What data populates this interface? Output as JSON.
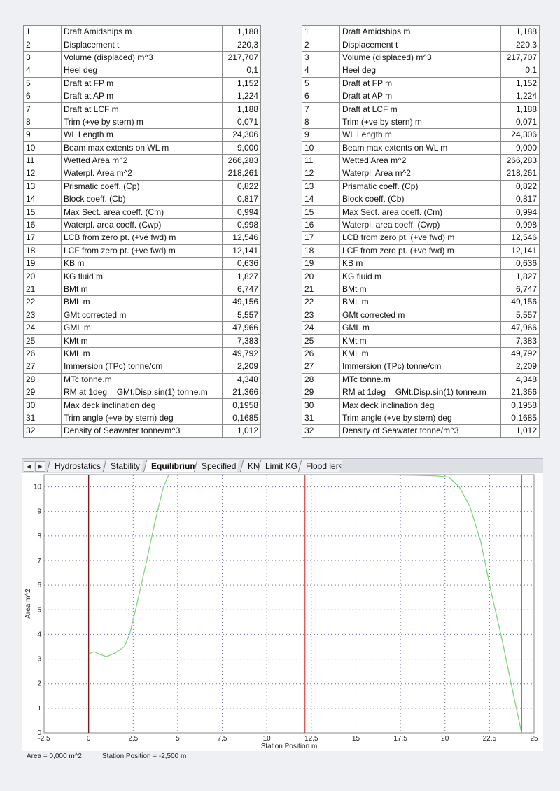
{
  "table_left": {
    "rows": [
      {
        "num": "1",
        "label": "Draft Amidships m",
        "value": "1,188"
      },
      {
        "num": "2",
        "label": "Displacement t",
        "value": "220,3"
      },
      {
        "num": "3",
        "label": "Volume (displaced) m^3",
        "value": "217,707"
      },
      {
        "num": "4",
        "label": "Heel deg",
        "value": "0,1"
      },
      {
        "num": "5",
        "label": "Draft at FP m",
        "value": "1,152"
      },
      {
        "num": "6",
        "label": "Draft at AP m",
        "value": "1,224"
      },
      {
        "num": "7",
        "label": "Draft at LCF m",
        "value": "1,188"
      },
      {
        "num": "8",
        "label": "Trim (+ve by stern) m",
        "value": "0,071"
      },
      {
        "num": "9",
        "label": "WL Length m",
        "value": "24,306"
      },
      {
        "num": "10",
        "label": "Beam max extents on WL m",
        "value": "9,000"
      },
      {
        "num": "11",
        "label": "Wetted Area m^2",
        "value": "266,283"
      },
      {
        "num": "12",
        "label": "Waterpl. Area m^2",
        "value": "218,261"
      },
      {
        "num": "13",
        "label": "Prismatic coeff. (Cp)",
        "value": "0,822"
      },
      {
        "num": "14",
        "label": "Block coeff. (Cb)",
        "value": "0,817"
      },
      {
        "num": "15",
        "label": "Max Sect. area coeff. (Cm)",
        "value": "0,994"
      },
      {
        "num": "16",
        "label": "Waterpl. area coeff. (Cwp)",
        "value": "0,998"
      },
      {
        "num": "17",
        "label": "LCB from zero pt. (+ve fwd) m",
        "value": "12,546"
      },
      {
        "num": "18",
        "label": "LCF from zero pt. (+ve fwd) m",
        "value": "12,141"
      },
      {
        "num": "19",
        "label": "KB m",
        "value": "0,636"
      },
      {
        "num": "20",
        "label": "KG fluid m",
        "value": "1,827"
      },
      {
        "num": "21",
        "label": "BMt m",
        "value": "6,747"
      },
      {
        "num": "22",
        "label": "BML m",
        "value": "49,156"
      },
      {
        "num": "23",
        "label": "GMt corrected m",
        "value": "5,557"
      },
      {
        "num": "24",
        "label": "GML m",
        "value": "47,966"
      },
      {
        "num": "25",
        "label": "KMt m",
        "value": "7,383"
      },
      {
        "num": "26",
        "label": "KML m",
        "value": "49,792"
      },
      {
        "num": "27",
        "label": "Immersion (TPc) tonne/cm",
        "value": "2,209"
      },
      {
        "num": "28",
        "label": "MTc tonne.m",
        "value": "4,348"
      },
      {
        "num": "29",
        "label": "RM at 1deg = GMt.Disp.sin(1) tonne.m",
        "value": "21,366"
      },
      {
        "num": "30",
        "label": "Max deck inclination deg",
        "value": "0,1958"
      },
      {
        "num": "31",
        "label": "Trim angle (+ve by stern) deg",
        "value": "0,1685"
      },
      {
        "num": "32",
        "label": "Density of Seawater tonne/m^3",
        "value": "1,012"
      }
    ]
  },
  "table_right": {
    "rows": [
      {
        "num": "1",
        "label": "Draft Amidships m",
        "value": "1,188"
      },
      {
        "num": "2",
        "label": "Displacement t",
        "value": "220,3"
      },
      {
        "num": "3",
        "label": "Volume (displaced) m^3",
        "value": "217,707"
      },
      {
        "num": "4",
        "label": "Heel deg",
        "value": "0,1"
      },
      {
        "num": "5",
        "label": "Draft at FP m",
        "value": "1,152"
      },
      {
        "num": "6",
        "label": "Draft at AP m",
        "value": "1,224"
      },
      {
        "num": "7",
        "label": "Draft at LCF m",
        "value": "1,188"
      },
      {
        "num": "8",
        "label": "Trim (+ve by stern) m",
        "value": "0,071"
      },
      {
        "num": "9",
        "label": "WL Length m",
        "value": "24,306"
      },
      {
        "num": "10",
        "label": "Beam max extents on WL m",
        "value": "9,000"
      },
      {
        "num": "11",
        "label": "Wetted Area m^2",
        "value": "266,283"
      },
      {
        "num": "12",
        "label": "Waterpl. Area m^2",
        "value": "218,261"
      },
      {
        "num": "13",
        "label": "Prismatic coeff. (Cp)",
        "value": "0,822"
      },
      {
        "num": "14",
        "label": "Block coeff. (Cb)",
        "value": "0,817"
      },
      {
        "num": "15",
        "label": "Max Sect. area coeff. (Cm)",
        "value": "0,994"
      },
      {
        "num": "16",
        "label": "Waterpl. area coeff. (Cwp)",
        "value": "0,998"
      },
      {
        "num": "17",
        "label": "LCB from zero pt. (+ve fwd) m",
        "value": "12,546"
      },
      {
        "num": "18",
        "label": "LCF from zero pt. (+ve fwd) m",
        "value": "12,141"
      },
      {
        "num": "19",
        "label": "KB m",
        "value": "0,636"
      },
      {
        "num": "20",
        "label": "KG fluid m",
        "value": "1,827"
      },
      {
        "num": "21",
        "label": "BMt m",
        "value": "6,747"
      },
      {
        "num": "22",
        "label": "BML m",
        "value": "49,156"
      },
      {
        "num": "23",
        "label": "GMt corrected m",
        "value": "5,557"
      },
      {
        "num": "24",
        "label": "GML m",
        "value": "47,966"
      },
      {
        "num": "25",
        "label": "KMt m",
        "value": "7,383"
      },
      {
        "num": "26",
        "label": "KML m",
        "value": "49,792"
      },
      {
        "num": "27",
        "label": "Immersion (TPc) tonne/cm",
        "value": "2,209"
      },
      {
        "num": "28",
        "label": "MTc tonne.m",
        "value": "4,348"
      },
      {
        "num": "29",
        "label": "RM at 1deg = GMt.Disp.sin(1) tonne.m",
        "value": "21,366"
      },
      {
        "num": "30",
        "label": "Max deck inclination deg",
        "value": "0,1958"
      },
      {
        "num": "31",
        "label": "Trim angle (+ve by stern) deg",
        "value": "0,1685"
      },
      {
        "num": "32",
        "label": "Density of Seawater tonne/m^3",
        "value": "1,012"
      }
    ]
  },
  "tabs": {
    "nav_prev_icon": "triangle-left-icon",
    "nav_next_icon": "triangle-right-icon",
    "items": [
      {
        "label": "Hydrostatics",
        "active": false
      },
      {
        "label": "Stability",
        "active": false
      },
      {
        "label": "Equilibrium",
        "active": true
      },
      {
        "label": "Specified",
        "active": false
      },
      {
        "label": "KN",
        "active": false
      },
      {
        "label": "Limit KG",
        "active": false
      },
      {
        "label": "Flood ler",
        "active": false
      }
    ],
    "scroll_glyph": "‹"
  },
  "chart_data": {
    "type": "line",
    "xlabel": "Station Position  m",
    "ylabel": "Area  m^2",
    "xlim": [
      -2.5,
      25
    ],
    "ylim": [
      0,
      10.5
    ],
    "x_ticks": [
      "-2,5",
      "0",
      "2,5",
      "5",
      "7,5",
      "10",
      "12,5",
      "15",
      "17,5",
      "20",
      "22,5",
      "25"
    ],
    "x_tick_values": [
      -2.5,
      0,
      2.5,
      5,
      7.5,
      10,
      12.5,
      15,
      17.5,
      20,
      22.5,
      25
    ],
    "y_ticks": [
      "0",
      "1",
      "2",
      "3",
      "4",
      "5",
      "6",
      "7",
      "8",
      "9",
      "10"
    ],
    "y_tick_values": [
      0,
      1,
      2,
      3,
      4,
      5,
      6,
      7,
      8,
      9,
      10
    ],
    "grid": true,
    "series": [
      {
        "color": "#7ed67e",
        "x": [
          0.0,
          0.3,
          0.6,
          1.0,
          1.5,
          2.0,
          2.3,
          2.7,
          3.2,
          3.7,
          4.2,
          4.5
        ],
        "y": [
          3.2,
          3.3,
          3.2,
          3.1,
          3.25,
          3.5,
          4.0,
          5.2,
          6.8,
          8.5,
          10.0,
          10.5
        ]
      },
      {
        "color": "#7ed67e",
        "x": [
          16.0,
          18.0,
          19.5,
          20.2,
          20.8,
          21.4,
          22.0,
          22.6,
          23.2,
          23.8,
          24.3
        ],
        "y": [
          10.5,
          10.48,
          10.45,
          10.4,
          10.0,
          9.2,
          7.8,
          5.7,
          3.8,
          1.7,
          0.0
        ]
      }
    ],
    "vertical_lines": [
      {
        "x": 0.0,
        "color": "#7a1a1a"
      },
      {
        "x": 12.141,
        "color": "#e05858"
      },
      {
        "x": 24.306,
        "color": "#e05858"
      }
    ]
  },
  "status": {
    "area": "Area =  0,000 m^2",
    "station": "Station Position =  -2,500 m"
  }
}
